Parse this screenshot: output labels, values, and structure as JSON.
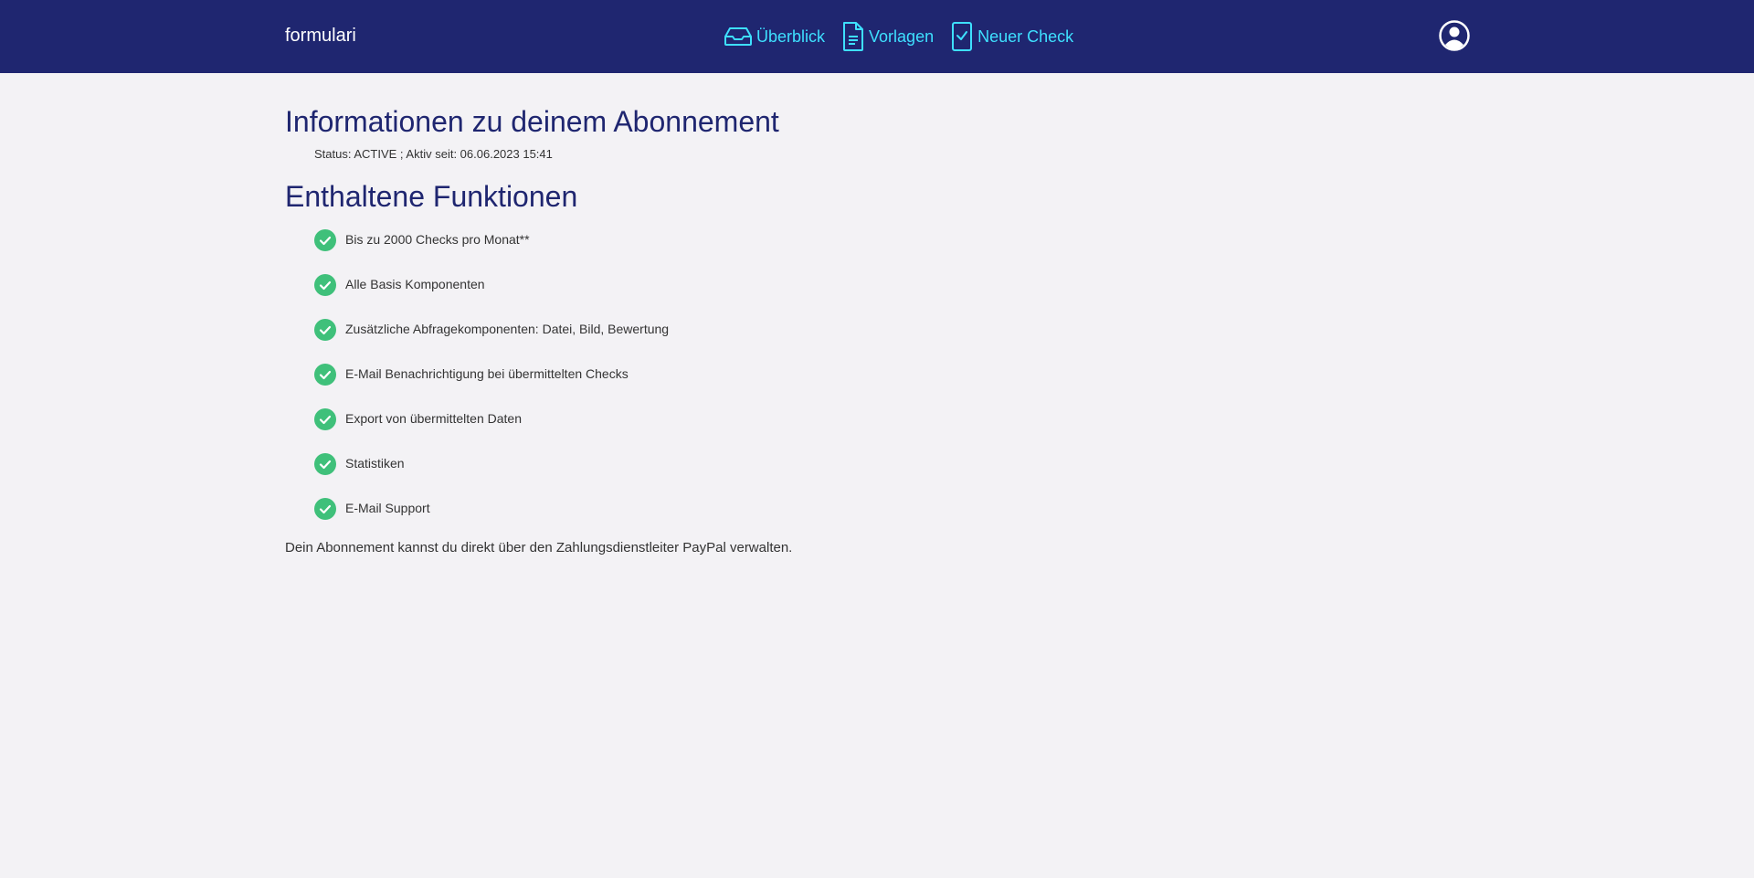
{
  "header": {
    "brand": "formulari",
    "nav": [
      {
        "label": "Überblick",
        "icon": "inbox-icon"
      },
      {
        "label": "Vorlagen",
        "icon": "document-icon"
      },
      {
        "label": "Neuer Check",
        "icon": "clipboard-check-icon"
      }
    ],
    "profile_icon": "user-circle-icon"
  },
  "subscription": {
    "title": "Informationen zu deinem Abonnement",
    "status_line": "Status: ACTIVE ; Aktiv seit: 06.06.2023 15:41"
  },
  "features": {
    "title": "Enthaltene Funktionen",
    "items": [
      "Bis zu 2000 Checks pro Monat**",
      "Alle Basis Komponenten",
      "Zusätzliche Abfragekomponenten: Datei, Bild, Bewertung",
      "E-Mail Benachrichtigung bei übermittelten Checks",
      "Export von übermittelten Daten",
      "Statistiken",
      "E-Mail Support"
    ]
  },
  "footer_note": "Dein Abonnement kannst du direkt über den Zahlungsdienstleiter PayPal verwalten.",
  "colors": {
    "navbar_bg": "#1f2670",
    "nav_link": "#3ee0ff",
    "heading": "#1f2670",
    "check_green": "#3fc07a",
    "page_bg": "#f3f2f5"
  }
}
